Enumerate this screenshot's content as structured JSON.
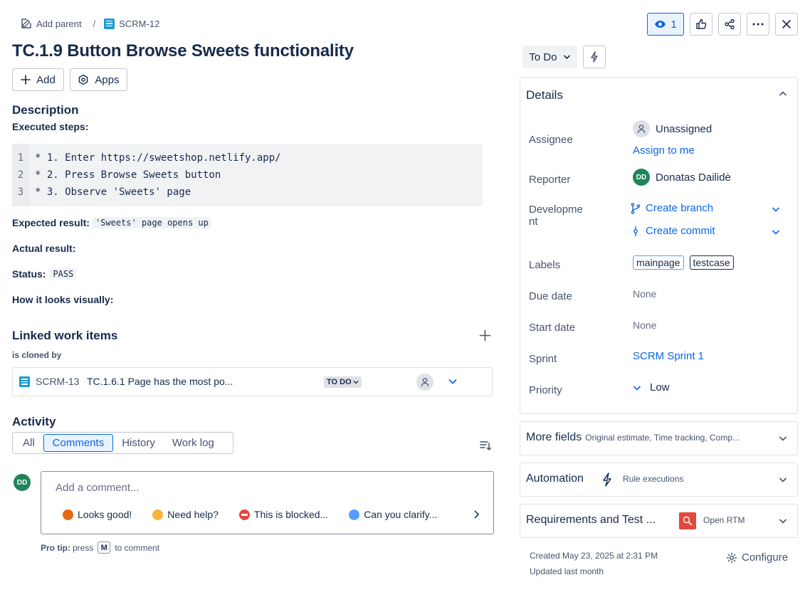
{
  "breadcrumb": {
    "add_parent": "Add parent",
    "separator": "/",
    "issue_key": "SCRM-12"
  },
  "title": "TC.1.9 Button Browse Sweets functionality",
  "actions": {
    "add": "Add",
    "apps": "Apps"
  },
  "description": {
    "heading": "Description",
    "executed_steps_label": "Executed steps:",
    "code_lines": [
      {
        "num": "1",
        "text": "* 1. Enter https://sweetshop.netlify.app/"
      },
      {
        "num": "2",
        "text": "* 2. Press Browse Sweets button"
      },
      {
        "num": "3",
        "text": "* 3. Observe 'Sweets' page"
      }
    ],
    "expected_label": "Expected result:",
    "expected_value": "'Sweets' page opens up",
    "actual_label": "Actual result:",
    "status_label": "Status:",
    "status_value": "PASS",
    "visual_label": "How it looks visually:"
  },
  "linked": {
    "heading": "Linked work items",
    "relation": "is cloned by",
    "item": {
      "key": "SCRM-13",
      "summary": "TC.1.6.1 Page has the most po...",
      "status": "TO DO"
    }
  },
  "activity": {
    "heading": "Activity",
    "tabs": [
      "All",
      "Comments",
      "History",
      "Work log"
    ],
    "active_tab": "Comments",
    "avatar_initials": "DD",
    "comment_placeholder": "Add a comment...",
    "chips": [
      {
        "label": "Looks good!",
        "icon": "party-popper-icon",
        "color": "#e56910"
      },
      {
        "label": "Need help?",
        "icon": "waving-hand-icon",
        "color": "#f5b73b"
      },
      {
        "label": "This is blocked...",
        "icon": "no-entry-icon",
        "color": "#e2483d"
      },
      {
        "label": "Can you clarify...",
        "icon": "magnifier-icon",
        "color": "#579dff"
      }
    ],
    "pro_tip_label": "Pro tip:",
    "pro_tip_pre": "press",
    "pro_tip_key": "M",
    "pro_tip_post": "to comment"
  },
  "header": {
    "watch_count": "1"
  },
  "status_button": "To Do",
  "details": {
    "heading": "Details",
    "assignee_label": "Assignee",
    "assignee_value": "Unassigned",
    "assign_to_me": "Assign to me",
    "reporter_label": "Reporter",
    "reporter_initials": "DD",
    "reporter_name": "Donatas Dailidė",
    "development_label_1": "Developme",
    "development_label_2": "nt",
    "create_branch": "Create branch",
    "create_commit": "Create commit",
    "labels_label": "Labels",
    "labels": [
      "mainpage",
      "testcase"
    ],
    "due_date_label": "Due date",
    "due_date_value": "None",
    "start_date_label": "Start date",
    "start_date_value": "None",
    "sprint_label": "Sprint",
    "sprint_value": "SCRM Sprint 1",
    "priority_label": "Priority",
    "priority_value": "Low"
  },
  "more_fields": {
    "heading": "More fields",
    "sub": "Original estimate, Time tracking, Comp..."
  },
  "automation": {
    "heading": "Automation",
    "sub": "Rule executions"
  },
  "requirements": {
    "heading": "Requirements and Test ...",
    "sub": "Open RTM"
  },
  "footer": {
    "created": "Created May 23, 2025 at 2:31 PM",
    "updated": "Updated last month",
    "configure": "Configure"
  },
  "colors": {
    "accent": "#0c66e4",
    "avatar_green": "#1f845a",
    "issue_blue": "#1d9bd1",
    "rtm_red": "#e2483d"
  }
}
